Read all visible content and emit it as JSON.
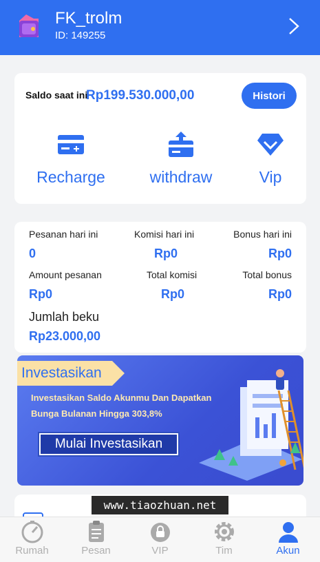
{
  "header": {
    "username": "FK_trolm",
    "user_id": "ID: 149255",
    "avatar_icon": "wallet-bag-icon",
    "chevron_icon": "chevron-right-icon"
  },
  "balance": {
    "label": "Saldo saat ini",
    "amount": "Rp199.530.000,00",
    "history_button": "Histori",
    "actions": [
      {
        "label": "Recharge",
        "icon": "credit-card-icon"
      },
      {
        "label": "withdraw",
        "icon": "withdraw-upload-icon"
      },
      {
        "label": "Vip",
        "icon": "diamond-icon"
      }
    ]
  },
  "stats": {
    "orders_today_label": "Pesanan hari ini",
    "orders_today_value": "0",
    "commission_today_label": "Komisi hari ini",
    "commission_today_value": "Rp0",
    "bonus_today_label": "Bonus hari ini",
    "bonus_today_value": "Rp0",
    "order_amount_label": "Amount pesanan",
    "order_amount_value": "Rp0",
    "total_commission_label": "Total komisi",
    "total_commission_value": "Rp0",
    "total_bonus_label": "Total bonus",
    "total_bonus_value": "Rp0",
    "frozen_label": "Jumlah beku",
    "frozen_value": "Rp23.000,00"
  },
  "banner": {
    "tag": "Investasikan",
    "line1": "Investasikan Saldo Akunmu Dan Dapatkan",
    "line2": "Bunga Bulanan Hingga 303,8%",
    "cta": "Mulai Investasikan"
  },
  "watermark": "www.tiaozhuan.net",
  "tabbar": {
    "active": "Akun",
    "items": [
      {
        "label": "Rumah",
        "icon": "speedometer-icon"
      },
      {
        "label": "Pesan",
        "icon": "clipboard-icon"
      },
      {
        "label": "VIP",
        "icon": "vip-lock-icon"
      },
      {
        "label": "Tim",
        "icon": "gear-icon"
      },
      {
        "label": "Akun",
        "icon": "user-icon"
      }
    ]
  },
  "colors": {
    "primary": "#2f6ff0",
    "background": "#f2f3f5",
    "inactive_tab": "#b0b0b0",
    "banner_text": "#fde9b1"
  }
}
